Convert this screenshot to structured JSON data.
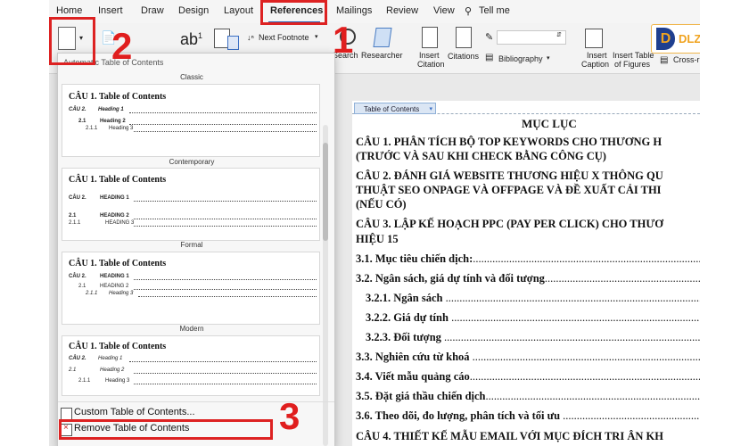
{
  "ribbon": {
    "tabs": [
      "Home",
      "Insert",
      "Draw",
      "Design",
      "Layout",
      "References",
      "Mailings",
      "Review",
      "View"
    ],
    "tell_me": "Tell me",
    "buttons": {
      "next_footnote": "Next Footnote",
      "search": "Search",
      "researcher": "Researcher",
      "insert_citation_1": "Insert",
      "insert_citation_2": "Citation",
      "citations": "Citations",
      "bibliography": "Bibliography",
      "insert_caption_1": "Insert",
      "insert_caption_2": "Caption",
      "insert_tof_1": "Insert Table",
      "insert_tof_2": "of Figures",
      "cross_ref": "Cross-r"
    }
  },
  "logo": {
    "text": "DLZ TECH",
    "letter": "D"
  },
  "annotations": {
    "n1": "1",
    "n2": "2",
    "n3": "3"
  },
  "menu": {
    "header": "Automatic Table of Contents",
    "sections": [
      {
        "label": "Classic",
        "title": "CÂU 1.     Table of Contents",
        "lines": [
          "CÂU 2.",
          "Heading 1",
          "2.1",
          "Heading 2",
          "2.1.1",
          "Heading 3"
        ]
      },
      {
        "label": "Contemporary",
        "title": "CÂU 1.     Table of Contents",
        "lines": [
          "CÂU 2.",
          "HEADING 1",
          "2.1",
          "HEADING 2",
          "2.1.1",
          "HEADING 3"
        ]
      },
      {
        "label": "Formal",
        "title": "CÂU 1.     Table of Contents",
        "lines": [
          "CÂU 2.",
          "HEADING 1",
          "2.1",
          "HEADING 2",
          "2.1.1",
          "Heading 3"
        ]
      },
      {
        "label": "Modern",
        "title": "CÂU 1.     Table of Contents",
        "lines": [
          "CÂU 2.",
          "Heading 1",
          "2.1",
          "Heading 2",
          "2.1.1",
          "Heading 3"
        ]
      }
    ],
    "custom": "Custom Table of Contents...",
    "remove": "Remove Table of Contents"
  },
  "document": {
    "toc_tag": "Table of Contents",
    "heading": "MỤC LỤC",
    "lines": [
      "CÂU 1.  PHÂN TÍCH BỘ TOP KEYWORDS CHO THƯƠNG H",
      "(TRƯỚC VÀ SAU KHI CHECK BẰNG CÔNG CỤ)",
      "CÂU 2.  ĐÁNH GIÁ WEBSITE THƯƠNG HIỆU X THÔNG QU",
      "THUẬT SEO ONPAGE VÀ OFFPAGE VÀ ĐỀ XUẤT CẢI THI",
      "(NẾU CÓ)",
      "CÂU 3.  LẬP KẾ HOẠCH PPC (PAY PER CLICK) CHO THƯƠ",
      "HIỆU     15",
      "3.1. Mục tiêu chiến dịch:",
      "3.2. Ngân sách, giá dự tính và đối tượng",
      "3.2.1. Ngân sách",
      "3.2.2. Giá dự tính",
      "3.2.3. Đối tượng",
      "3.3. Nghiên cứu từ khoá",
      "3.4. Viết mẫu quảng cáo",
      "3.5. Đặt giá thầu chiến dịch",
      "3.6. Theo dõi, đo lượng, phân tích và tối ưu",
      "CÂU 4.  THIẾT KẾ MẪU EMAIL VỚI MỤC ĐÍCH TRI ÂN KH"
    ],
    "dots": "............................................................................................................................"
  },
  "colors": {
    "annotation_red": "#d22222",
    "tab_accent": "#2b5fb3",
    "logo_orange": "#f0a31f"
  }
}
